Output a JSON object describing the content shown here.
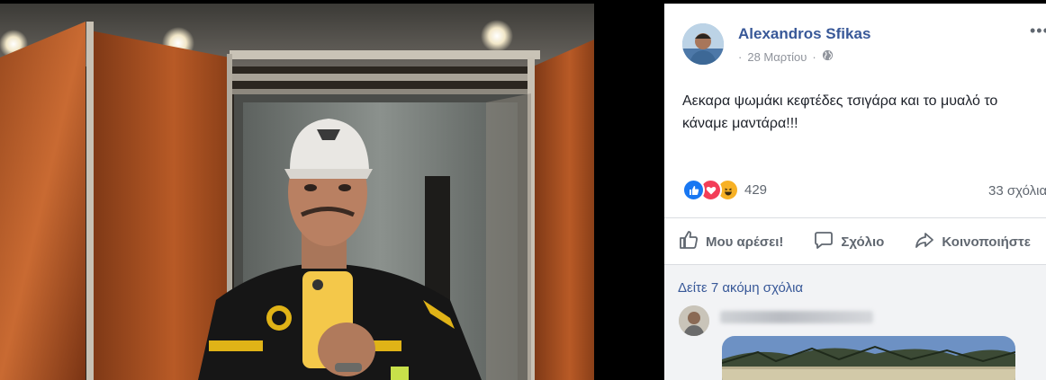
{
  "post": {
    "author": "Alexandros Sfikas",
    "date": "28 Μαρτίου",
    "separator": "·",
    "more_label": "•••",
    "text_line1": "Αεκαρα ψωμάκι κεφτέδες τσιγάρα και το μυαλό το",
    "text_line2": "κάναμε μαντάρα!!!",
    "reaction_count": "429",
    "comment_count": "33 σχόλια",
    "reactions": [
      "like-icon",
      "love-icon",
      "haha-icon"
    ]
  },
  "actions": {
    "like_label": "Μου αρέσει!",
    "comment_label": "Σχόλιο",
    "share_label": "Κοινοποιήστε"
  },
  "comments": {
    "view_more_label": "Δείτε 7 ακόμη σχόλια"
  },
  "colors": {
    "link": "#385898",
    "muted": "#606770",
    "like_blue": "#1877f2",
    "love_red": "#f33e58",
    "haha_yellow": "#f7b125"
  }
}
